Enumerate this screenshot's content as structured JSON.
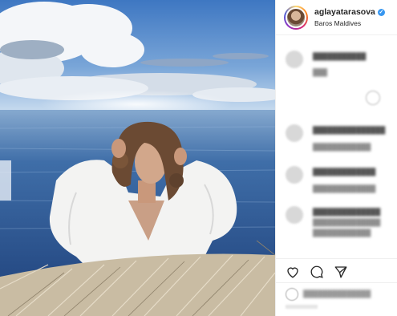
{
  "post": {
    "username": "aglayatarasova",
    "location": "Baros Maldives",
    "verified_mark": "✓"
  },
  "icons": {
    "verified": "verified-badge-icon",
    "like": "heart-icon",
    "comment": "comment-bubble-icon",
    "share": "paper-plane-icon",
    "options": "more-options-icon",
    "emoji": "smile-icon"
  },
  "colors": {
    "verified": "#3897f0",
    "border": "#efefef",
    "sea": "#2f5f9e",
    "sky": "#6d9bd3"
  }
}
